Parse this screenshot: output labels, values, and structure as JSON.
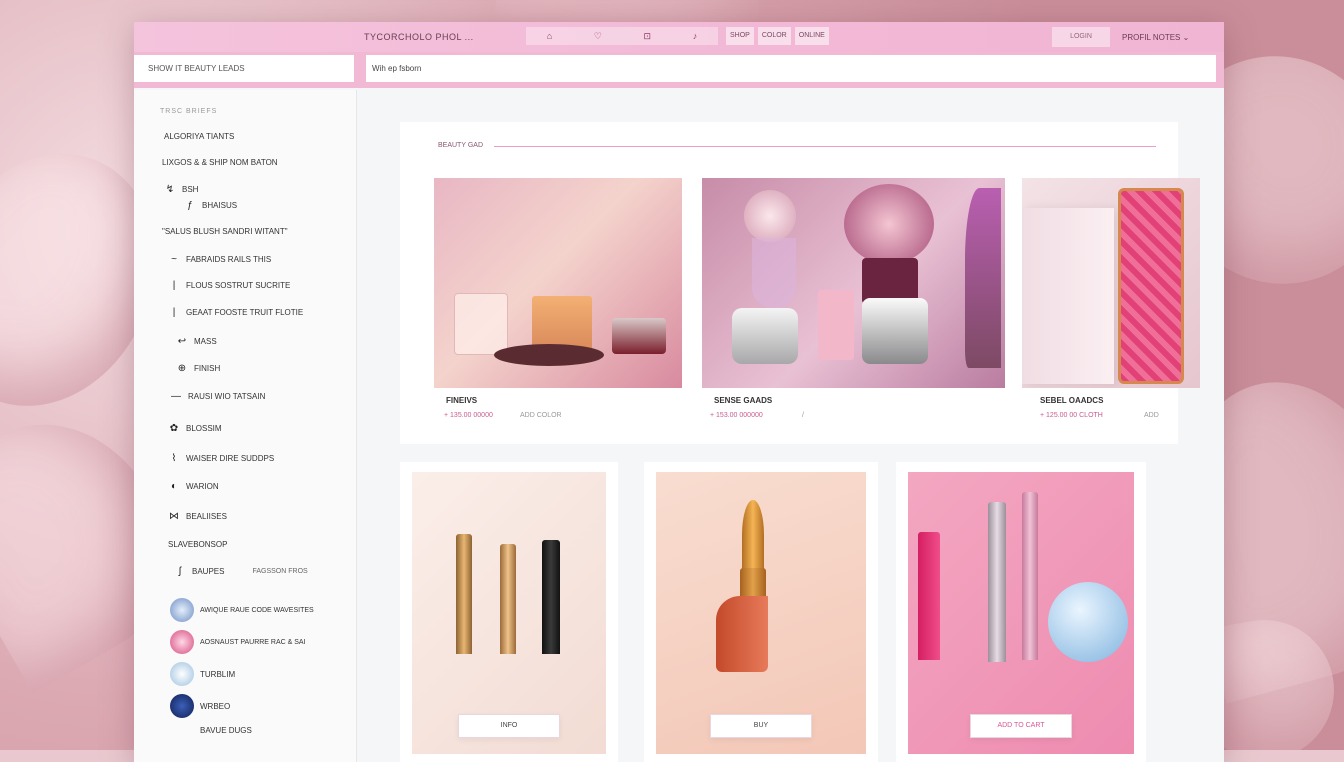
{
  "window": {
    "title": "TYCORCHOLO PHOL ...",
    "toolbar_icons": [
      "home-icon",
      "heart-icon",
      "bag-icon",
      "bell-icon"
    ],
    "toolbar_glyphs": [
      "⌂",
      "♡",
      "⊡",
      "♪"
    ],
    "tabs": [
      "SHOP",
      "COLOR",
      "ONLINE"
    ],
    "header_button": "LOGIN",
    "account_label": "PROFIL NOTES"
  },
  "search": {
    "sidebar_placeholder": "SHOW IT BEAUTY LEADS",
    "main_placeholder": "Wih ep fsborn"
  },
  "sidebar": {
    "heading": "TRSC BRIEFS",
    "items": [
      {
        "label": "ALGORIYA TIANTS",
        "icon": ""
      },
      {
        "label": "LIXGOS & & SHIP NOM BATON",
        "icon": ""
      },
      {
        "label": "BSH",
        "icon": "↯"
      },
      {
        "label": "BHAISUS",
        "icon": "ƒ"
      },
      {
        "label": "\"SALUS BLUSH SANDRI WITANT\"",
        "icon": ""
      },
      {
        "label": "FABRAIDS RAILS THIS",
        "icon": "~"
      },
      {
        "label": "FLOUS   SOSTRUT SUCRITE",
        "icon": "|"
      },
      {
        "label": "GEAAT FOOSTE TRUIT FLOTIE",
        "icon": "|"
      },
      {
        "label": "MASS",
        "icon": "↩"
      },
      {
        "label": "FINISH",
        "icon": "⊕"
      },
      {
        "label": "RAUSI WIO TATSAIN",
        "icon": "—"
      },
      {
        "label": "BLOSSIM",
        "icon": "✿"
      },
      {
        "label": "WAISER DIRE SUDDPS",
        "icon": "⌇"
      },
      {
        "label": "WARION",
        "icon": "◐"
      },
      {
        "label": "BEALIISES",
        "icon": "⋈"
      },
      {
        "label": "SLAVEBONSOP",
        "icon": ""
      },
      {
        "label": "BAUPES",
        "icon": "ʃ"
      },
      {
        "label": "FAGSSON FROS",
        "icon": ""
      }
    ],
    "profiles": [
      {
        "label": "AWIQUE RAUE CODE WAVESITES"
      },
      {
        "label": "AOSNAUST PAURRE RAC & SAI"
      },
      {
        "label": "TURBLIM"
      },
      {
        "label": "WRBEO"
      },
      {
        "label": "BAVUE DUGS"
      }
    ]
  },
  "section": {
    "title": "BEAUTY GAD"
  },
  "products_row1": [
    {
      "name": "FINEIVS",
      "price": "+ 135.00 00000",
      "meta": "ADD COLOR"
    },
    {
      "name": "SENSE GAADS",
      "price": "+ 153.00 000000",
      "meta": "/"
    },
    {
      "name": "SEBEL OAADCS",
      "price": "+ 125.00 00 CLOTH",
      "meta": "ADD"
    }
  ],
  "products_row2": [
    {
      "button": "INFO"
    },
    {
      "button": "BUY"
    },
    {
      "button": "ADD TO CART"
    }
  ]
}
